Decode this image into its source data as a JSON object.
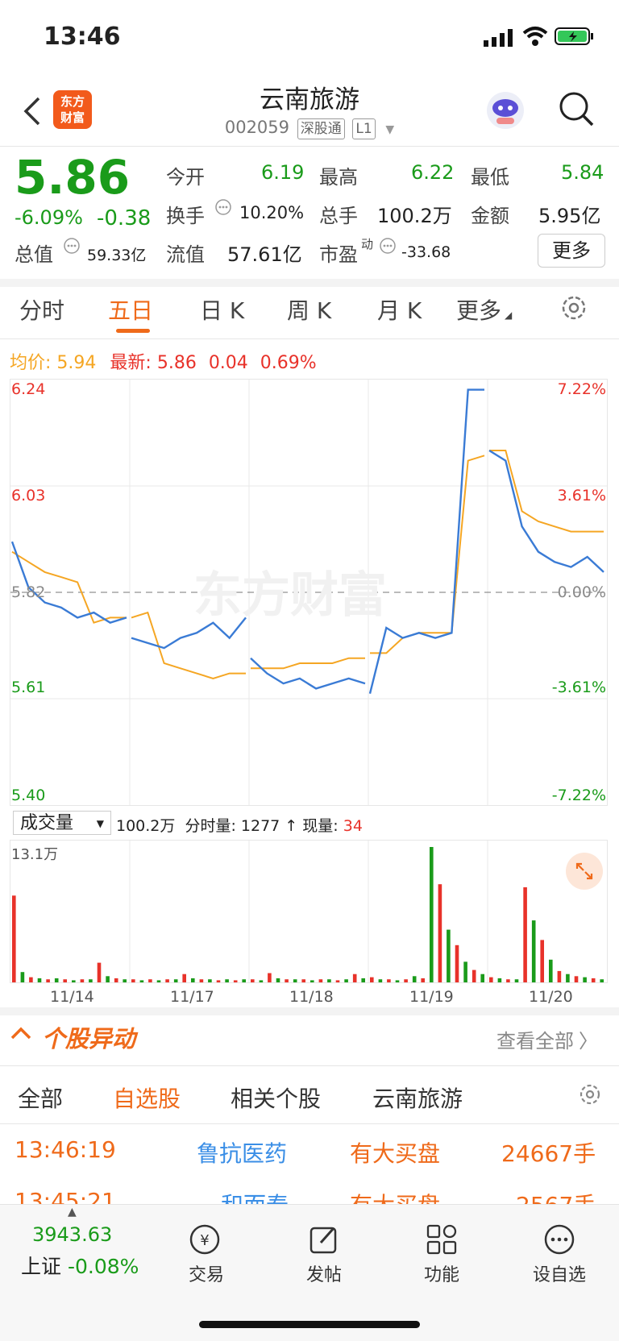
{
  "status": {
    "time": "13:46"
  },
  "header": {
    "title": "云南旅游",
    "code": "002059",
    "tag1": "深股通",
    "tag2": "L1",
    "logo_text_1": "东方",
    "logo_text_2": "财富"
  },
  "quote": {
    "price": "5.86",
    "change_pct": "-6.09%",
    "change": "-0.38",
    "open_label": "今开",
    "open": "6.19",
    "high_label": "最高",
    "high": "6.22",
    "low_label": "最低",
    "low": "5.84",
    "turnover_label": "换手",
    "turnover": "10.20%",
    "volume_label": "总手",
    "volume": "100.2万",
    "amount_label": "金额",
    "amount": "5.95亿",
    "mcap_label": "总值",
    "mcap": "59.33亿",
    "float_label": "流值",
    "float": "57.61亿",
    "pe_label": "市盈",
    "pe_sup": "动",
    "pe": "-33.68",
    "more": "更多"
  },
  "tabs": [
    "分时",
    "五日",
    "日 K",
    "周 K",
    "月 K",
    "更多"
  ],
  "legend": {
    "avg_label": "均价:",
    "avg": "5.94",
    "last_label": "最新:",
    "last": "5.86",
    "chg": "0.04",
    "chg_pct": "0.69%"
  },
  "chart_data": {
    "type": "line",
    "x": [
      "11/14",
      "11/17",
      "11/18",
      "11/19",
      "11/20"
    ],
    "ylim": [
      5.4,
      6.24
    ],
    "y_ticks_left": [
      "6.24",
      "6.03",
      "5.82",
      "5.61",
      "5.40"
    ],
    "y_ticks_right": [
      "7.22%",
      "3.61%",
      "0.00%",
      "-3.61%",
      "-7.22%"
    ],
    "prev_close": 5.82,
    "series": [
      {
        "name": "最新",
        "color": "#3a7bd5",
        "values": [
          5.92,
          5.83,
          5.8,
          5.79,
          5.77,
          5.78,
          5.76,
          5.77,
          5.73,
          5.72,
          5.71,
          5.73,
          5.74,
          5.76,
          5.73,
          5.77,
          5.69,
          5.66,
          5.64,
          5.65,
          5.63,
          5.64,
          5.65,
          5.64,
          5.62,
          5.75,
          5.73,
          5.74,
          5.73,
          5.74,
          6.22,
          6.22,
          6.1,
          6.08,
          5.95,
          5.9,
          5.88,
          5.87,
          5.89,
          5.86
        ]
      },
      {
        "name": "均价",
        "color": "#f5a623",
        "values": [
          5.9,
          5.88,
          5.86,
          5.85,
          5.84,
          5.76,
          5.77,
          5.77,
          5.77,
          5.78,
          5.68,
          5.67,
          5.66,
          5.65,
          5.66,
          5.66,
          5.67,
          5.67,
          5.67,
          5.68,
          5.68,
          5.68,
          5.69,
          5.69,
          5.7,
          5.7,
          5.73,
          5.74,
          5.74,
          5.74,
          6.08,
          6.09,
          6.1,
          6.1,
          5.98,
          5.96,
          5.95,
          5.94,
          5.94,
          5.94
        ]
      }
    ]
  },
  "volume_header": {
    "select": "成交量",
    "total": "100.2万",
    "minute_label": "分时量:",
    "minute": "1277",
    "now_label": "现量:",
    "now": "34",
    "ymax_label": "13.1万"
  },
  "volume_data": {
    "ymax": 13.1,
    "values": [
      8.4,
      1.0,
      0.5,
      0.4,
      0.3,
      0.4,
      0.3,
      0.2,
      0.3,
      0.3,
      1.9,
      0.6,
      0.4,
      0.3,
      0.3,
      0.2,
      0.3,
      0.2,
      0.3,
      0.3,
      0.8,
      0.4,
      0.3,
      0.3,
      0.2,
      0.3,
      0.2,
      0.3,
      0.3,
      0.2,
      0.9,
      0.4,
      0.3,
      0.3,
      0.3,
      0.2,
      0.3,
      0.3,
      0.2,
      0.3,
      0.8,
      0.4,
      0.5,
      0.3,
      0.3,
      0.2,
      0.3,
      0.6,
      0.4,
      13.1,
      9.5,
      5.1,
      3.6,
      2.0,
      1.2,
      0.8,
      0.5,
      0.4,
      0.3,
      0.3,
      9.2,
      6.0,
      4.1,
      2.2,
      1.1,
      0.8,
      0.6,
      0.5,
      0.4,
      0.3
    ]
  },
  "news": {
    "title": "个股异动",
    "view_all": "查看全部",
    "filters": [
      "全部",
      "自选股",
      "相关个股",
      "云南旅游"
    ],
    "rows": [
      {
        "time": "13:46:19",
        "stock": "鲁抗医药",
        "event": "有大买盘",
        "amount": "24667手"
      },
      {
        "time": "13:45:21",
        "stock": "和而泰",
        "event": "有大买盘",
        "amount": "2567手"
      }
    ]
  },
  "bottom": {
    "index_value": "3943.63",
    "index_name": "上证",
    "index_chg": "-0.08%",
    "nav": [
      "交易",
      "发帖",
      "功能",
      "设自选"
    ]
  }
}
